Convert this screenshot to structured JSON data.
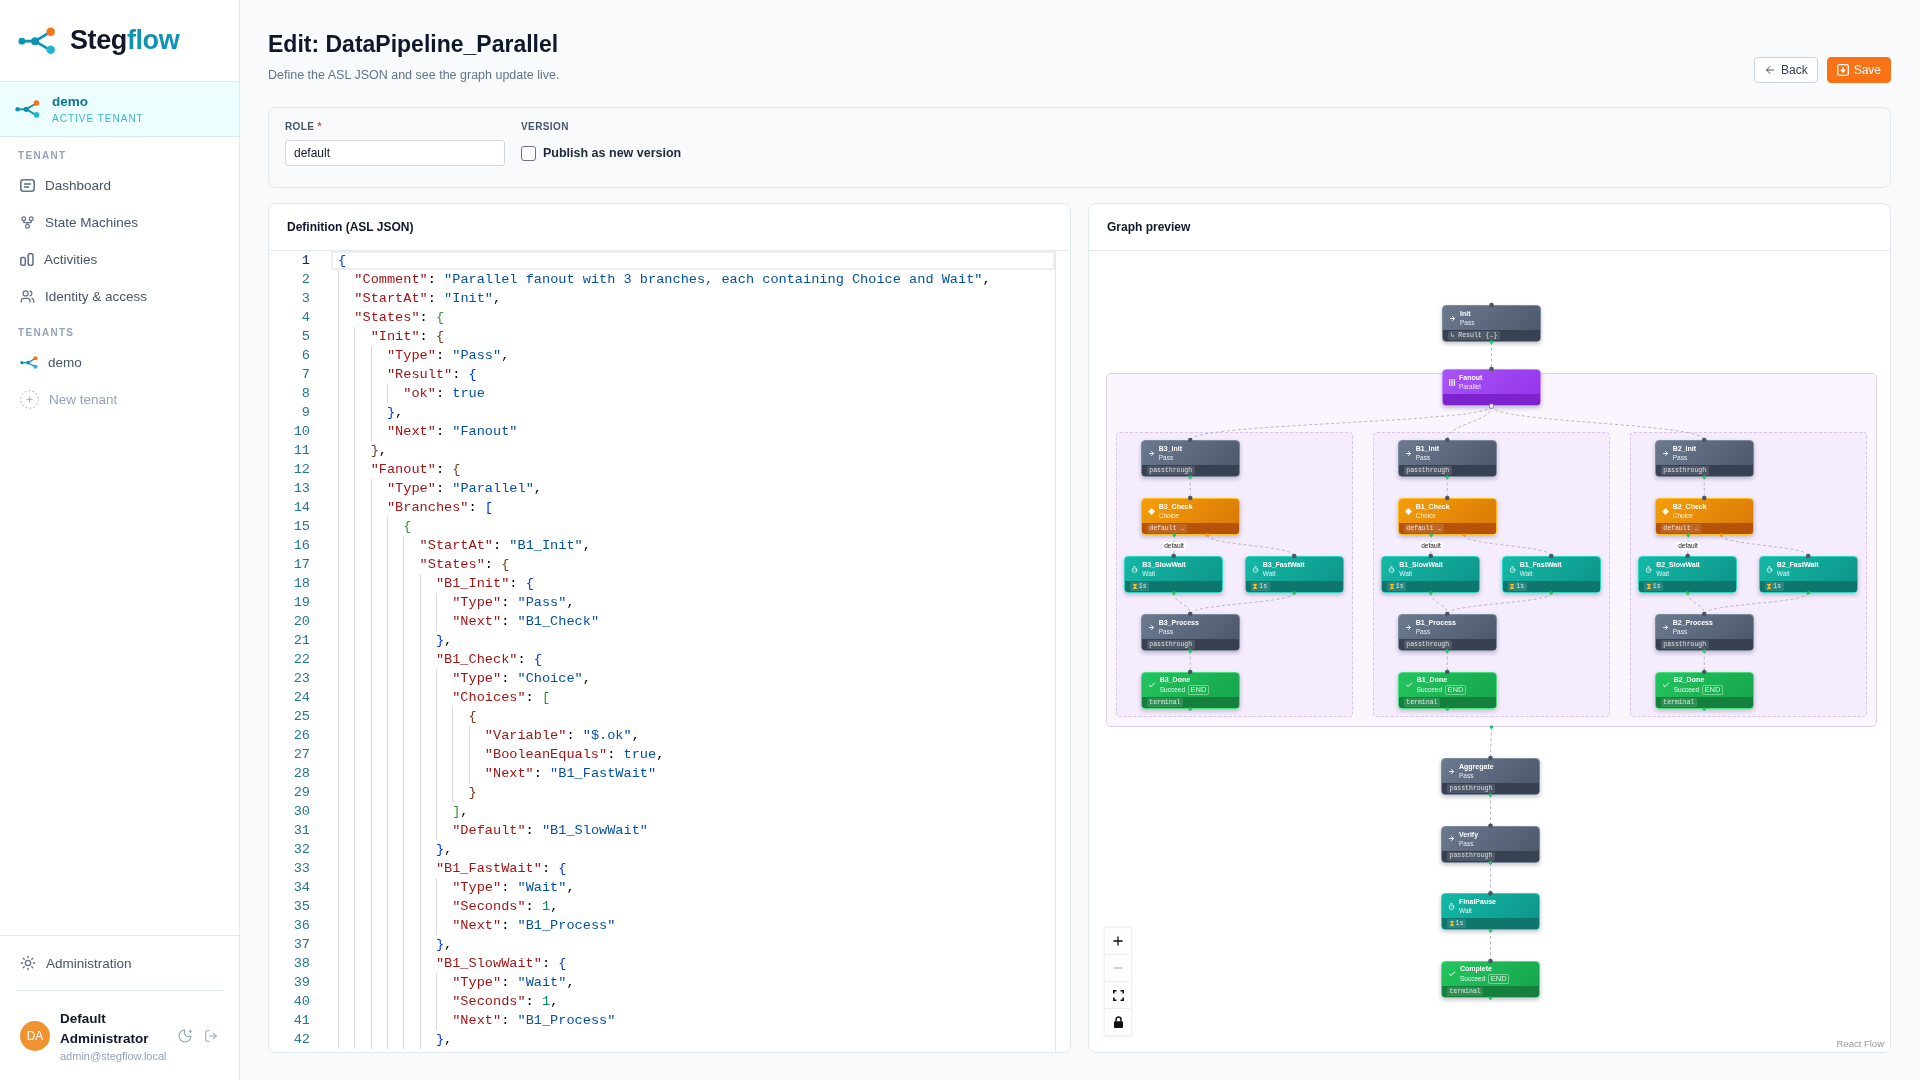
{
  "sidebar": {
    "brand": {
      "name": "Steg",
      "accent": "flow"
    },
    "active_tenant": {
      "name": "demo",
      "caption": "ACTIVE TENANT"
    },
    "sections": [
      {
        "title": "TENANT",
        "items": [
          {
            "label": "Dashboard",
            "kind": "dashboard",
            "selected": false
          },
          {
            "label": "State Machines",
            "kind": "machines",
            "selected": false
          },
          {
            "label": "Activities",
            "kind": "activities",
            "selected": false
          },
          {
            "label": "Identity & access",
            "kind": "identity",
            "selected": false
          }
        ]
      },
      {
        "title": "TENANTS",
        "items": [
          {
            "label": "demo",
            "kind": "tenant",
            "selected": false
          },
          {
            "label": "New tenant",
            "kind": "add",
            "selected": false
          }
        ]
      }
    ],
    "admin": {
      "label": "Administration"
    },
    "user": {
      "initials": "DA",
      "name": "Default Administrator",
      "email": "admin@stegflow.local"
    }
  },
  "header": {
    "title": "Edit: DataPipeline_Parallel",
    "subtitle": "Define the ASL JSON and see the graph update live.",
    "actions": [
      {
        "label": "Back",
        "kind": "back"
      },
      {
        "label": "Save",
        "kind": "save"
      }
    ]
  },
  "form": {
    "role": {
      "label": "ROLE",
      "required_mark": "*",
      "value": "default"
    },
    "version": {
      "label": "VERSION",
      "option": "Publish as new version",
      "checked": false
    }
  },
  "definition": {
    "title": "Definition (ASL JSON)",
    "lines": [
      {
        "number": "1",
        "text": "{",
        "current": true
      },
      {
        "number": "2",
        "text": "  \"Comment\": \"Parallel fanout with 3 branches, each containing Choice and Wait\",",
        "current": false
      },
      {
        "number": "3",
        "text": "  \"StartAt\": \"Init\",",
        "current": false
      },
      {
        "number": "4",
        "text": "  \"States\": {",
        "current": false
      },
      {
        "number": "5",
        "text": "    \"Init\": {",
        "current": false
      },
      {
        "number": "6",
        "text": "      \"Type\": \"Pass\",",
        "current": false
      },
      {
        "number": "7",
        "text": "      \"Result\": {",
        "current": false
      },
      {
        "number": "8",
        "text": "        \"ok\": true",
        "current": false
      },
      {
        "number": "9",
        "text": "      },",
        "current": false
      },
      {
        "number": "10",
        "text": "      \"Next\": \"Fanout\"",
        "current": false
      },
      {
        "number": "11",
        "text": "    },",
        "current": false
      },
      {
        "number": "12",
        "text": "    \"Fanout\": {",
        "current": false
      },
      {
        "number": "13",
        "text": "      \"Type\": \"Parallel\",",
        "current": false
      },
      {
        "number": "14",
        "text": "      \"Branches\": [",
        "current": false
      },
      {
        "number": "15",
        "text": "        {",
        "current": false
      },
      {
        "number": "16",
        "text": "          \"StartAt\": \"B1_Init\",",
        "current": false
      },
      {
        "number": "17",
        "text": "          \"States\": {",
        "current": false
      },
      {
        "number": "18",
        "text": "            \"B1_Init\": {",
        "current": false
      },
      {
        "number": "19",
        "text": "              \"Type\": \"Pass\",",
        "current": false
      },
      {
        "number": "20",
        "text": "              \"Next\": \"B1_Check\"",
        "current": false
      },
      {
        "number": "21",
        "text": "            },",
        "current": false
      },
      {
        "number": "22",
        "text": "            \"B1_Check\": {",
        "current": false
      },
      {
        "number": "23",
        "text": "              \"Type\": \"Choice\",",
        "current": false
      },
      {
        "number": "24",
        "text": "              \"Choices\": [",
        "current": false
      },
      {
        "number": "25",
        "text": "                {",
        "current": false
      },
      {
        "number": "26",
        "text": "                  \"Variable\": \"$.ok\",",
        "current": false
      },
      {
        "number": "27",
        "text": "                  \"BooleanEquals\": true,",
        "current": false
      },
      {
        "number": "28",
        "text": "                  \"Next\": \"B1_FastWait\"",
        "current": false
      },
      {
        "number": "29",
        "text": "                }",
        "current": false
      },
      {
        "number": "30",
        "text": "              ],",
        "current": false
      },
      {
        "number": "31",
        "text": "              \"Default\": \"B1_SlowWait\"",
        "current": false
      },
      {
        "number": "32",
        "text": "            },",
        "current": false
      },
      {
        "number": "33",
        "text": "            \"B1_FastWait\": {",
        "current": false
      },
      {
        "number": "34",
        "text": "              \"Type\": \"Wait\",",
        "current": false
      },
      {
        "number": "35",
        "text": "              \"Seconds\": 1,",
        "current": false
      },
      {
        "number": "36",
        "text": "              \"Next\": \"B1_Process\"",
        "current": false
      },
      {
        "number": "37",
        "text": "            },",
        "current": false
      },
      {
        "number": "38",
        "text": "            \"B1_SlowWait\": {",
        "current": false
      },
      {
        "number": "39",
        "text": "              \"Type\": \"Wait\",",
        "current": false
      },
      {
        "number": "40",
        "text": "              \"Seconds\": 1,",
        "current": false
      },
      {
        "number": "41",
        "text": "              \"Next\": \"B1_Process\"",
        "current": false
      },
      {
        "number": "42",
        "text": "            },",
        "current": false
      }
    ]
  },
  "graph_preview": {
    "title": "Graph preview",
    "head_nodes": [
      {
        "name": "Init",
        "type": "Pass",
        "kind": "pass",
        "chip": "↳ Result {…}"
      }
    ],
    "parallel": {
      "name": "Fanout",
      "type": "Parallel",
      "kind": "parallel",
      "branches": [
        {
          "default_label": "default",
          "rows": [
            [
              {
                "name": "B3_Init",
                "type": "Pass",
                "kind": "pass",
                "chip": "passthrough"
              }
            ],
            [
              {
                "name": "B3_Check",
                "type": "Choice",
                "kind": "choice",
                "chip": "default …"
              }
            ],
            [
              {
                "name": "B3_SlowWait",
                "type": "Wait",
                "kind": "wait",
                "chip": "1s"
              },
              {
                "name": "B3_FastWait",
                "type": "Wait",
                "kind": "wait",
                "chip": "1s"
              }
            ],
            [
              {
                "name": "B3_Process",
                "type": "Pass",
                "kind": "pass",
                "chip": "passthrough"
              }
            ],
            [
              {
                "name": "B3_Done",
                "type": "Succeed",
                "kind": "succeed",
                "badge": "END",
                "chip": "terminal"
              }
            ]
          ]
        },
        {
          "default_label": "default",
          "rows": [
            [
              {
                "name": "B1_Init",
                "type": "Pass",
                "kind": "pass",
                "chip": "passthrough"
              }
            ],
            [
              {
                "name": "B1_Check",
                "type": "Choice",
                "kind": "choice",
                "chip": "default …"
              }
            ],
            [
              {
                "name": "B1_SlowWait",
                "type": "Wait",
                "kind": "wait",
                "chip": "1s"
              },
              {
                "name": "B1_FastWait",
                "type": "Wait",
                "kind": "wait",
                "chip": "1s"
              }
            ],
            [
              {
                "name": "B1_Process",
                "type": "Pass",
                "kind": "pass",
                "chip": "passthrough"
              }
            ],
            [
              {
                "name": "B1_Done",
                "type": "Succeed",
                "kind": "succeed",
                "badge": "END",
                "chip": "terminal"
              }
            ]
          ]
        },
        {
          "default_label": "default",
          "rows": [
            [
              {
                "name": "B2_Init",
                "type": "Pass",
                "kind": "pass",
                "chip": "passthrough"
              }
            ],
            [
              {
                "name": "B2_Check",
                "type": "Choice",
                "kind": "choice",
                "chip": "default …"
              }
            ],
            [
              {
                "name": "B2_SlowWait",
                "type": "Wait",
                "kind": "wait",
                "chip": "1s"
              },
              {
                "name": "B2_FastWait",
                "type": "Wait",
                "kind": "wait",
                "chip": "1s"
              }
            ],
            [
              {
                "name": "B2_Process",
                "type": "Pass",
                "kind": "pass",
                "chip": "passthrough"
              }
            ],
            [
              {
                "name": "B2_Done",
                "type": "Succeed",
                "kind": "succeed",
                "badge": "END",
                "chip": "terminal"
              }
            ]
          ]
        }
      ]
    },
    "tail_nodes": [
      {
        "name": "Aggregate",
        "type": "Pass",
        "kind": "pass",
        "chip": "passthrough"
      },
      {
        "name": "Verify",
        "type": "Pass",
        "kind": "pass",
        "chip": "passthrough"
      },
      {
        "name": "FinalPause",
        "type": "Wait",
        "kind": "wait",
        "chip": "1s"
      },
      {
        "name": "Complete",
        "type": "Succeed",
        "kind": "succeed",
        "badge": "END",
        "chip": "terminal"
      }
    ],
    "controls": [
      {
        "kind": "zoom_in",
        "disabled": false
      },
      {
        "kind": "zoom_out",
        "disabled": true
      },
      {
        "kind": "fit",
        "disabled": false
      },
      {
        "kind": "lock",
        "disabled": false
      }
    ],
    "attribution": "React Flow"
  }
}
